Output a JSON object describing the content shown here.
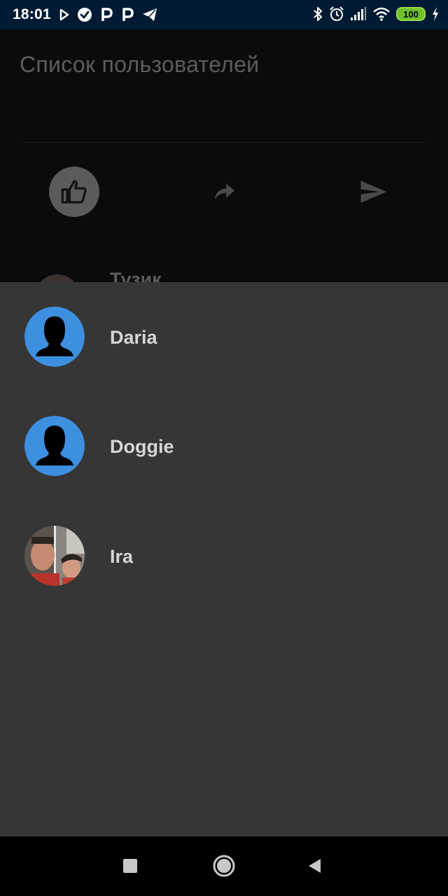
{
  "status_bar": {
    "time": "18:01",
    "battery_level": "100",
    "left_icons": [
      "play-store-icon",
      "check-circle-icon",
      "p-icon",
      "p-icon",
      "telegram-icon"
    ],
    "right_icons": [
      "bluetooth-icon",
      "alarm-icon",
      "signal-icon",
      "wifi-icon",
      "battery-icon",
      "charging-icon"
    ],
    "background_color": "#001a33",
    "battery_color": "#6cc12c"
  },
  "background_screen": {
    "title": "Список пользователей",
    "actions": [
      "like-icon",
      "forward-icon",
      "send-icon"
    ],
    "peek_item_name": "Тузик"
  },
  "user_list": {
    "items": [
      {
        "name": "Daria",
        "avatar": "default-user-icon"
      },
      {
        "name": "Doggie",
        "avatar": "default-user-icon"
      },
      {
        "name": "Ira",
        "avatar": "photo"
      }
    ],
    "avatar_color": "#3d8fe0",
    "sheet_color": "#363636"
  },
  "nav_bar": {
    "buttons": [
      "recents-icon",
      "home-icon",
      "back-icon"
    ]
  }
}
